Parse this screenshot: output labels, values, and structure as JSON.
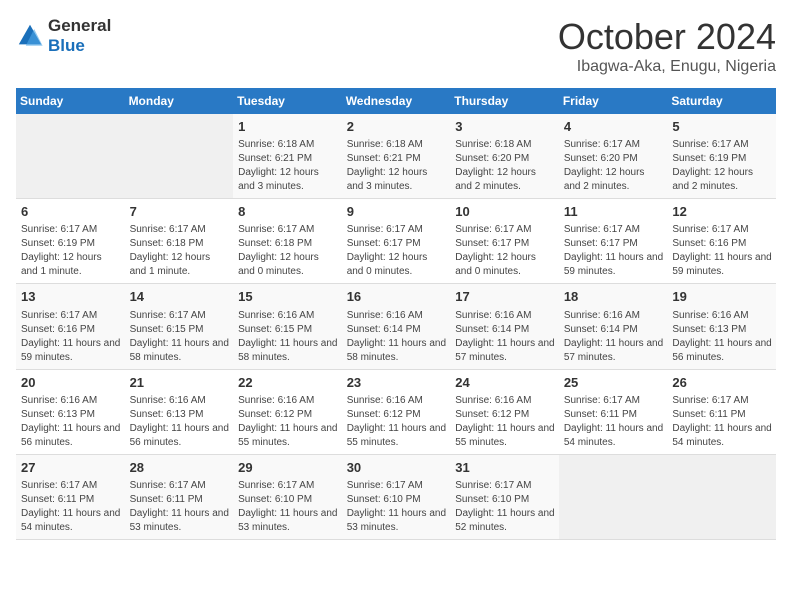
{
  "logo": {
    "text_general": "General",
    "text_blue": "Blue"
  },
  "header": {
    "month_title": "October 2024",
    "location": "Ibagwa-Aka, Enugu, Nigeria"
  },
  "weekdays": [
    "Sunday",
    "Monday",
    "Tuesday",
    "Wednesday",
    "Thursday",
    "Friday",
    "Saturday"
  ],
  "weeks": [
    [
      {
        "day": "",
        "sunrise": "",
        "sunset": "",
        "daylight": "",
        "empty": true
      },
      {
        "day": "",
        "sunrise": "",
        "sunset": "",
        "daylight": "",
        "empty": true
      },
      {
        "day": "1",
        "sunrise": "Sunrise: 6:18 AM",
        "sunset": "Sunset: 6:21 PM",
        "daylight": "Daylight: 12 hours and 3 minutes."
      },
      {
        "day": "2",
        "sunrise": "Sunrise: 6:18 AM",
        "sunset": "Sunset: 6:21 PM",
        "daylight": "Daylight: 12 hours and 3 minutes."
      },
      {
        "day": "3",
        "sunrise": "Sunrise: 6:18 AM",
        "sunset": "Sunset: 6:20 PM",
        "daylight": "Daylight: 12 hours and 2 minutes."
      },
      {
        "day": "4",
        "sunrise": "Sunrise: 6:17 AM",
        "sunset": "Sunset: 6:20 PM",
        "daylight": "Daylight: 12 hours and 2 minutes."
      },
      {
        "day": "5",
        "sunrise": "Sunrise: 6:17 AM",
        "sunset": "Sunset: 6:19 PM",
        "daylight": "Daylight: 12 hours and 2 minutes."
      }
    ],
    [
      {
        "day": "6",
        "sunrise": "Sunrise: 6:17 AM",
        "sunset": "Sunset: 6:19 PM",
        "daylight": "Daylight: 12 hours and 1 minute."
      },
      {
        "day": "7",
        "sunrise": "Sunrise: 6:17 AM",
        "sunset": "Sunset: 6:18 PM",
        "daylight": "Daylight: 12 hours and 1 minute."
      },
      {
        "day": "8",
        "sunrise": "Sunrise: 6:17 AM",
        "sunset": "Sunset: 6:18 PM",
        "daylight": "Daylight: 12 hours and 0 minutes."
      },
      {
        "day": "9",
        "sunrise": "Sunrise: 6:17 AM",
        "sunset": "Sunset: 6:17 PM",
        "daylight": "Daylight: 12 hours and 0 minutes."
      },
      {
        "day": "10",
        "sunrise": "Sunrise: 6:17 AM",
        "sunset": "Sunset: 6:17 PM",
        "daylight": "Daylight: 12 hours and 0 minutes."
      },
      {
        "day": "11",
        "sunrise": "Sunrise: 6:17 AM",
        "sunset": "Sunset: 6:17 PM",
        "daylight": "Daylight: 11 hours and 59 minutes."
      },
      {
        "day": "12",
        "sunrise": "Sunrise: 6:17 AM",
        "sunset": "Sunset: 6:16 PM",
        "daylight": "Daylight: 11 hours and 59 minutes."
      }
    ],
    [
      {
        "day": "13",
        "sunrise": "Sunrise: 6:17 AM",
        "sunset": "Sunset: 6:16 PM",
        "daylight": "Daylight: 11 hours and 59 minutes."
      },
      {
        "day": "14",
        "sunrise": "Sunrise: 6:17 AM",
        "sunset": "Sunset: 6:15 PM",
        "daylight": "Daylight: 11 hours and 58 minutes."
      },
      {
        "day": "15",
        "sunrise": "Sunrise: 6:16 AM",
        "sunset": "Sunset: 6:15 PM",
        "daylight": "Daylight: 11 hours and 58 minutes."
      },
      {
        "day": "16",
        "sunrise": "Sunrise: 6:16 AM",
        "sunset": "Sunset: 6:14 PM",
        "daylight": "Daylight: 11 hours and 58 minutes."
      },
      {
        "day": "17",
        "sunrise": "Sunrise: 6:16 AM",
        "sunset": "Sunset: 6:14 PM",
        "daylight": "Daylight: 11 hours and 57 minutes."
      },
      {
        "day": "18",
        "sunrise": "Sunrise: 6:16 AM",
        "sunset": "Sunset: 6:14 PM",
        "daylight": "Daylight: 11 hours and 57 minutes."
      },
      {
        "day": "19",
        "sunrise": "Sunrise: 6:16 AM",
        "sunset": "Sunset: 6:13 PM",
        "daylight": "Daylight: 11 hours and 56 minutes."
      }
    ],
    [
      {
        "day": "20",
        "sunrise": "Sunrise: 6:16 AM",
        "sunset": "Sunset: 6:13 PM",
        "daylight": "Daylight: 11 hours and 56 minutes."
      },
      {
        "day": "21",
        "sunrise": "Sunrise: 6:16 AM",
        "sunset": "Sunset: 6:13 PM",
        "daylight": "Daylight: 11 hours and 56 minutes."
      },
      {
        "day": "22",
        "sunrise": "Sunrise: 6:16 AM",
        "sunset": "Sunset: 6:12 PM",
        "daylight": "Daylight: 11 hours and 55 minutes."
      },
      {
        "day": "23",
        "sunrise": "Sunrise: 6:16 AM",
        "sunset": "Sunset: 6:12 PM",
        "daylight": "Daylight: 11 hours and 55 minutes."
      },
      {
        "day": "24",
        "sunrise": "Sunrise: 6:16 AM",
        "sunset": "Sunset: 6:12 PM",
        "daylight": "Daylight: 11 hours and 55 minutes."
      },
      {
        "day": "25",
        "sunrise": "Sunrise: 6:17 AM",
        "sunset": "Sunset: 6:11 PM",
        "daylight": "Daylight: 11 hours and 54 minutes."
      },
      {
        "day": "26",
        "sunrise": "Sunrise: 6:17 AM",
        "sunset": "Sunset: 6:11 PM",
        "daylight": "Daylight: 11 hours and 54 minutes."
      }
    ],
    [
      {
        "day": "27",
        "sunrise": "Sunrise: 6:17 AM",
        "sunset": "Sunset: 6:11 PM",
        "daylight": "Daylight: 11 hours and 54 minutes."
      },
      {
        "day": "28",
        "sunrise": "Sunrise: 6:17 AM",
        "sunset": "Sunset: 6:11 PM",
        "daylight": "Daylight: 11 hours and 53 minutes."
      },
      {
        "day": "29",
        "sunrise": "Sunrise: 6:17 AM",
        "sunset": "Sunset: 6:10 PM",
        "daylight": "Daylight: 11 hours and 53 minutes."
      },
      {
        "day": "30",
        "sunrise": "Sunrise: 6:17 AM",
        "sunset": "Sunset: 6:10 PM",
        "daylight": "Daylight: 11 hours and 53 minutes."
      },
      {
        "day": "31",
        "sunrise": "Sunrise: 6:17 AM",
        "sunset": "Sunset: 6:10 PM",
        "daylight": "Daylight: 11 hours and 52 minutes."
      },
      {
        "day": "",
        "sunrise": "",
        "sunset": "",
        "daylight": "",
        "empty": true
      },
      {
        "day": "",
        "sunrise": "",
        "sunset": "",
        "daylight": "",
        "empty": true
      }
    ]
  ]
}
